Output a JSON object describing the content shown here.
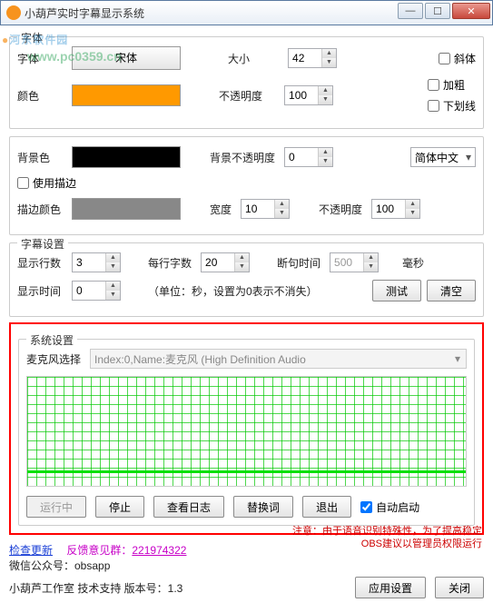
{
  "window": {
    "title": "小葫芦实时字幕显示系统"
  },
  "winbtns": {
    "min": "—",
    "max": "☐",
    "close": "✕"
  },
  "watermark": {
    "logo_a": "●",
    "text": "河东软件园",
    "url": "www.pc0359.cn"
  },
  "font_group": {
    "legend": "字体",
    "font_label": "字体",
    "font_value": "宋体",
    "size_label": "大小",
    "size_value": "42",
    "color_label": "颜色",
    "color_value": "#ff9900",
    "opacity_label": "不透明度",
    "opacity_value": "100",
    "italic": "斜体",
    "bold": "加粗",
    "underline": "下划线"
  },
  "bg_group": {
    "bg_label": "背景色",
    "bg_color": "#000000",
    "bg_opacity_label": "背景不透明度",
    "bg_opacity_value": "0",
    "lang_value": "简体中文",
    "stroke_enable": "使用描边",
    "stroke_color_label": "描边颜色",
    "stroke_color": "#888888",
    "width_label": "宽度",
    "width_value": "10",
    "stroke_opacity_label": "不透明度",
    "stroke_opacity_value": "100"
  },
  "subtitle": {
    "legend": "字幕设置",
    "lines_label": "显示行数",
    "lines_value": "3",
    "perline_label": "每行字数",
    "perline_value": "20",
    "break_label": "断句时间",
    "break_value": "500",
    "break_unit": "毫秒",
    "showtime_label": "显示时间",
    "showtime_value": "0",
    "showtime_note": "（单位：秒，设置为0表示不消失）",
    "test_btn": "测试",
    "clear_btn": "清空"
  },
  "system": {
    "legend": "系统设置",
    "mic_label": "麦克风选择",
    "mic_value": "Index:0,Name:麦克风 (High Definition Audio",
    "running": "运行中",
    "stop": "停止",
    "viewlog": "查看日志",
    "replace": "替换词",
    "exit": "退出",
    "autostart": "自动启动"
  },
  "footer": {
    "check_update": "检查更新",
    "feedback_label": "反馈意见群：",
    "feedback_qq": "221974322",
    "note": "注意：由于语音识别特殊性，为了提高稳定OBS建议以管理员权限运行",
    "wechat": "微信公众号：obsapp",
    "studio": "小葫芦工作室 技术支持 版本号：1.3",
    "apply": "应用设置",
    "close": "关闭"
  }
}
